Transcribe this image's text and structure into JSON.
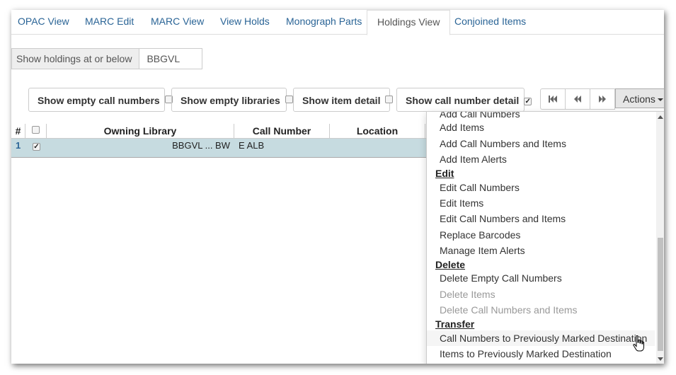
{
  "tabs": [
    "OPAC View",
    "MARC Edit",
    "MARC View",
    "View Holds",
    "Monograph Parts",
    "Holdings View",
    "Conjoined Items"
  ],
  "holdings": {
    "label": "Show holdings at or below",
    "value": "BBGVL"
  },
  "options": [
    {
      "label": "Show empty call numbers",
      "checked": false
    },
    {
      "label": "Show empty libraries",
      "checked": false
    },
    {
      "label": "Show item detail",
      "checked": false
    },
    {
      "label": "Show call number detail",
      "checked": true
    }
  ],
  "actions_label": "Actions",
  "grid": {
    "headers": [
      "#",
      "",
      "Owning Library",
      "Call Number",
      "Location"
    ],
    "row": {
      "num": "1",
      "library": "BBGVL ... BW",
      "call_number": "E ALB",
      "location": ""
    }
  },
  "menu": {
    "partial_item": "Add Call Numbers",
    "add_items": [
      "Add Items",
      "Add Call Numbers and Items",
      "Add Item Alerts"
    ],
    "edit_header": "Edit",
    "edit_items": [
      "Edit Call Numbers",
      "Edit Items",
      "Edit Call Numbers and Items",
      "Replace Barcodes",
      "Manage Item Alerts"
    ],
    "delete_header": "Delete",
    "delete_items": [
      "Delete Empty Call Numbers",
      "Delete Items",
      "Delete Call Numbers and Items"
    ],
    "transfer_header": "Transfer",
    "transfer_items": [
      "Call Numbers to Previously Marked Destination",
      "Items to Previously Marked Destination"
    ]
  },
  "colors": {
    "link": "#2a6496",
    "row_selected": "#c6dbe0",
    "disabled": "#999999"
  }
}
